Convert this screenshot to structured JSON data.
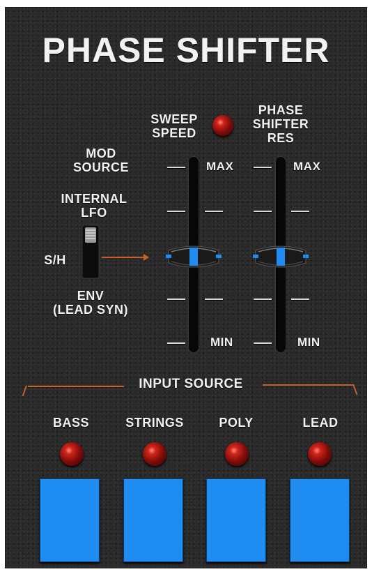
{
  "title": "PHASE SHIFTER",
  "mod_source": {
    "heading_line1": "MOD",
    "heading_line2": "SOURCE",
    "option_top_line1": "INTERNAL",
    "option_top_line2": "LFO",
    "option_left": "S/H",
    "option_bottom_line1": "ENV",
    "option_bottom_line2": "(LEAD SYN)"
  },
  "sweep_speed": {
    "label_line1": "SWEEP",
    "label_line2": "SPEED",
    "max_label": "MAX",
    "min_label": "MIN",
    "level": 0.5
  },
  "phase_shifter_res": {
    "label_line1": "PHASE",
    "label_line2": "SHIFTER",
    "label_line3": "RES",
    "max_label": "MAX",
    "min_label": "MIN",
    "level": 0.5
  },
  "input_source": {
    "heading": "INPUT SOURCE",
    "buttons": [
      {
        "label": "BASS"
      },
      {
        "label": "STRINGS"
      },
      {
        "label": "POLY"
      },
      {
        "label": "LEAD"
      }
    ]
  },
  "colors": {
    "panel": "#2a2a2b",
    "pad_blue": "#1e8cf0",
    "led_red": "#d1241a",
    "accent_orange": "#c8602a"
  }
}
